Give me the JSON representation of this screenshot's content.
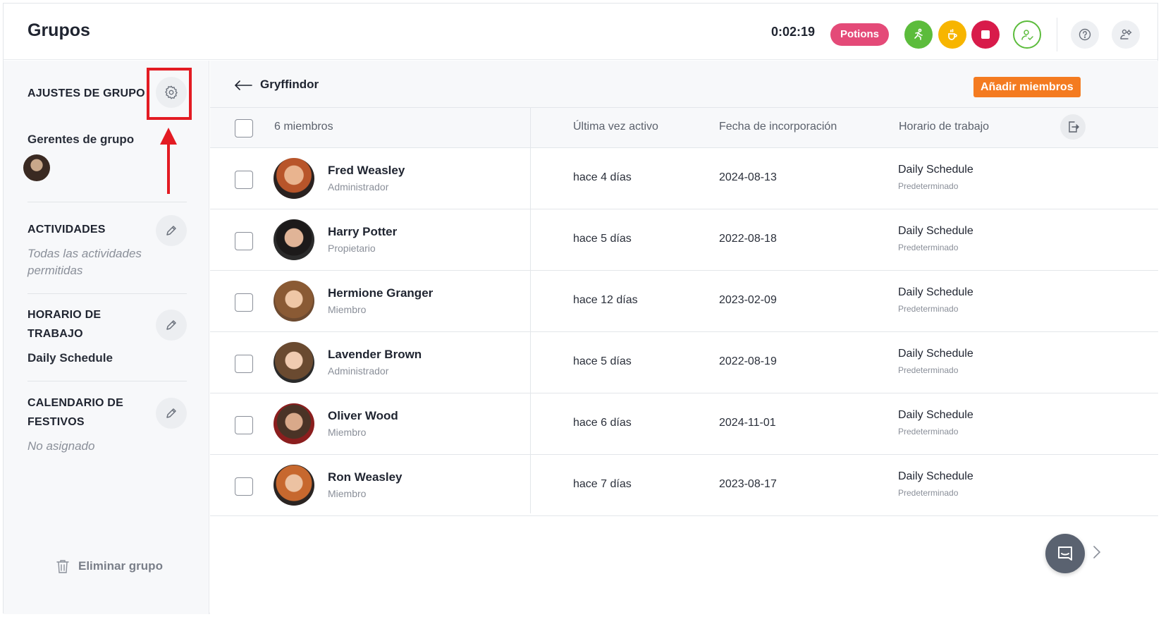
{
  "header": {
    "title": "Grupos",
    "timer": "0:02:19",
    "project_tag": "Potions",
    "colors": {
      "project": "#e44a78",
      "green": "#5cbc3c",
      "yellow": "#f7b500",
      "red": "#d81b4a"
    }
  },
  "sidebar": {
    "settings_title": "AJUSTES DE GRUPO",
    "managers_label": "Gerentes de grupo",
    "activities": {
      "title": "ACTIVIDADES",
      "value": "Todas las actividades permitidas"
    },
    "schedule": {
      "title_line1": "HORARIO DE",
      "title_line2": "TRABAJO",
      "value": "Daily Schedule"
    },
    "holidays": {
      "title_line1": "CALENDARIO DE",
      "title_line2": "FESTIVOS",
      "value": "No asignado"
    },
    "delete_label": "Eliminar grupo"
  },
  "main": {
    "group_name": "Gryffindor",
    "add_members_label": "Añadir miembros",
    "accent_color": "#f47b20",
    "columns": {
      "members": "6 miembros",
      "last_active": "Última vez activo",
      "join_date": "Fecha de incorporación",
      "schedule": "Horario de trabajo"
    },
    "rows": [
      {
        "name": "Fred Weasley",
        "role": "Administrador",
        "last_active": "hace 4 días",
        "joined": "2024-08-13",
        "schedule": "Daily Schedule",
        "schedule_note": "Predeterminado"
      },
      {
        "name": "Harry Potter",
        "role": "Propietario",
        "last_active": "hace 5 días",
        "joined": "2022-08-18",
        "schedule": "Daily Schedule",
        "schedule_note": "Predeterminado"
      },
      {
        "name": "Hermione Granger",
        "role": "Miembro",
        "last_active": "hace 12 días",
        "joined": "2023-02-09",
        "schedule": "Daily Schedule",
        "schedule_note": "Predeterminado"
      },
      {
        "name": "Lavender Brown",
        "role": "Administrador",
        "last_active": "hace 5 días",
        "joined": "2022-08-19",
        "schedule": "Daily Schedule",
        "schedule_note": "Predeterminado"
      },
      {
        "name": "Oliver Wood",
        "role": "Miembro",
        "last_active": "hace 6 días",
        "joined": "2024-11-01",
        "schedule": "Daily Schedule",
        "schedule_note": "Predeterminado"
      },
      {
        "name": "Ron Weasley",
        "role": "Miembro",
        "last_active": "hace 7 días",
        "joined": "2023-08-17",
        "schedule": "Daily Schedule",
        "schedule_note": "Predeterminado"
      }
    ]
  }
}
